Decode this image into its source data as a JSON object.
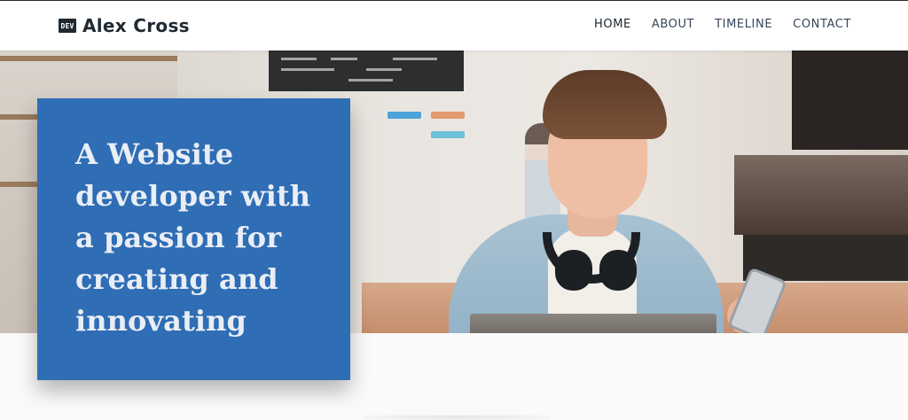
{
  "brand": {
    "icon_text": "DEV",
    "name": "Alex Cross"
  },
  "nav": {
    "items": [
      {
        "label": "HOME",
        "active": true
      },
      {
        "label": "ABOUT",
        "active": false
      },
      {
        "label": "TIMELINE",
        "active": false
      },
      {
        "label": "CONTACT",
        "active": false
      }
    ]
  },
  "hero": {
    "headline": "A Website developer with a passion for creating and innovating",
    "image_subject": "person-with-headphones-in-cafe"
  },
  "colors": {
    "navbar_bg": "#ffffff",
    "brand_text": "#1f2a33",
    "nav_text": "#37465a",
    "callout_bg": "#2f6db5",
    "callout_text": "#e9eef5",
    "page_bg": "#fafafa"
  }
}
